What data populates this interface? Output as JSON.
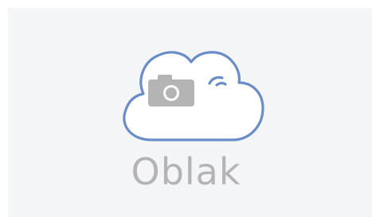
{
  "logo": {
    "wordmark": "Oblak",
    "icon_names": [
      "cloud-icon",
      "camera-icon",
      "wink-icon"
    ],
    "colors": {
      "background": "#f4f5f7",
      "cloud_outline": "#6a8cc8",
      "camera": "#b4b4b4",
      "wordmark": "#b4b4b4"
    }
  }
}
